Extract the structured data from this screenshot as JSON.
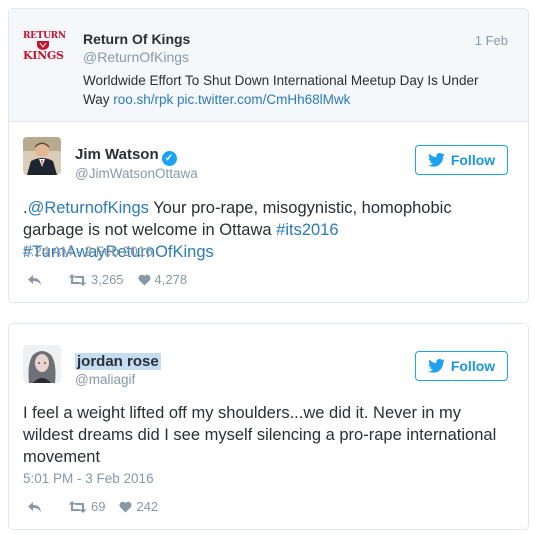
{
  "quoted_tweet": {
    "logo_top": "RETURN",
    "logo_bottom": "KINGS",
    "name": "Return Of Kings",
    "handle": "@ReturnOfKings",
    "date": "1 Feb",
    "text": "Worldwide Effort To Shut Down International Meetup Day Is Under Way ",
    "link1": "roo.sh/rpk",
    "link2": "pic.twitter.com/CmHh68lMwk"
  },
  "tweet1": {
    "name": "Jim Watson",
    "handle": "@JimWatsonOttawa",
    "follow_label": "Follow",
    "text_prefix": ".",
    "mention": "@ReturnofKings",
    "text_body": " Your pro-rape, misogynistic, homophobic garbage is not welcome in Ottawa ",
    "hashtag1": "#its2016",
    "hashtag2": "#TurnAwayReturnOfKings",
    "timestamp": "5:24 AM - 2 Feb 2016",
    "retweets": "3,265",
    "likes": "4,278"
  },
  "tweet2": {
    "name": "jordan rose",
    "handle": "@maliagif",
    "follow_label": "Follow",
    "text": "I feel a weight lifted off my shoulders...we did it. Never in my wildest dreams did I see myself silencing a pro-rape international movement",
    "timestamp": "5:01 PM - 3 Feb 2016",
    "retweets": "69",
    "likes": "242"
  },
  "colors": {
    "link": "#2b7bb9",
    "follow": "#1da1f2",
    "muted": "#8899a6",
    "highlight": "#c5dcf5",
    "logo_red": "#c8102e"
  }
}
